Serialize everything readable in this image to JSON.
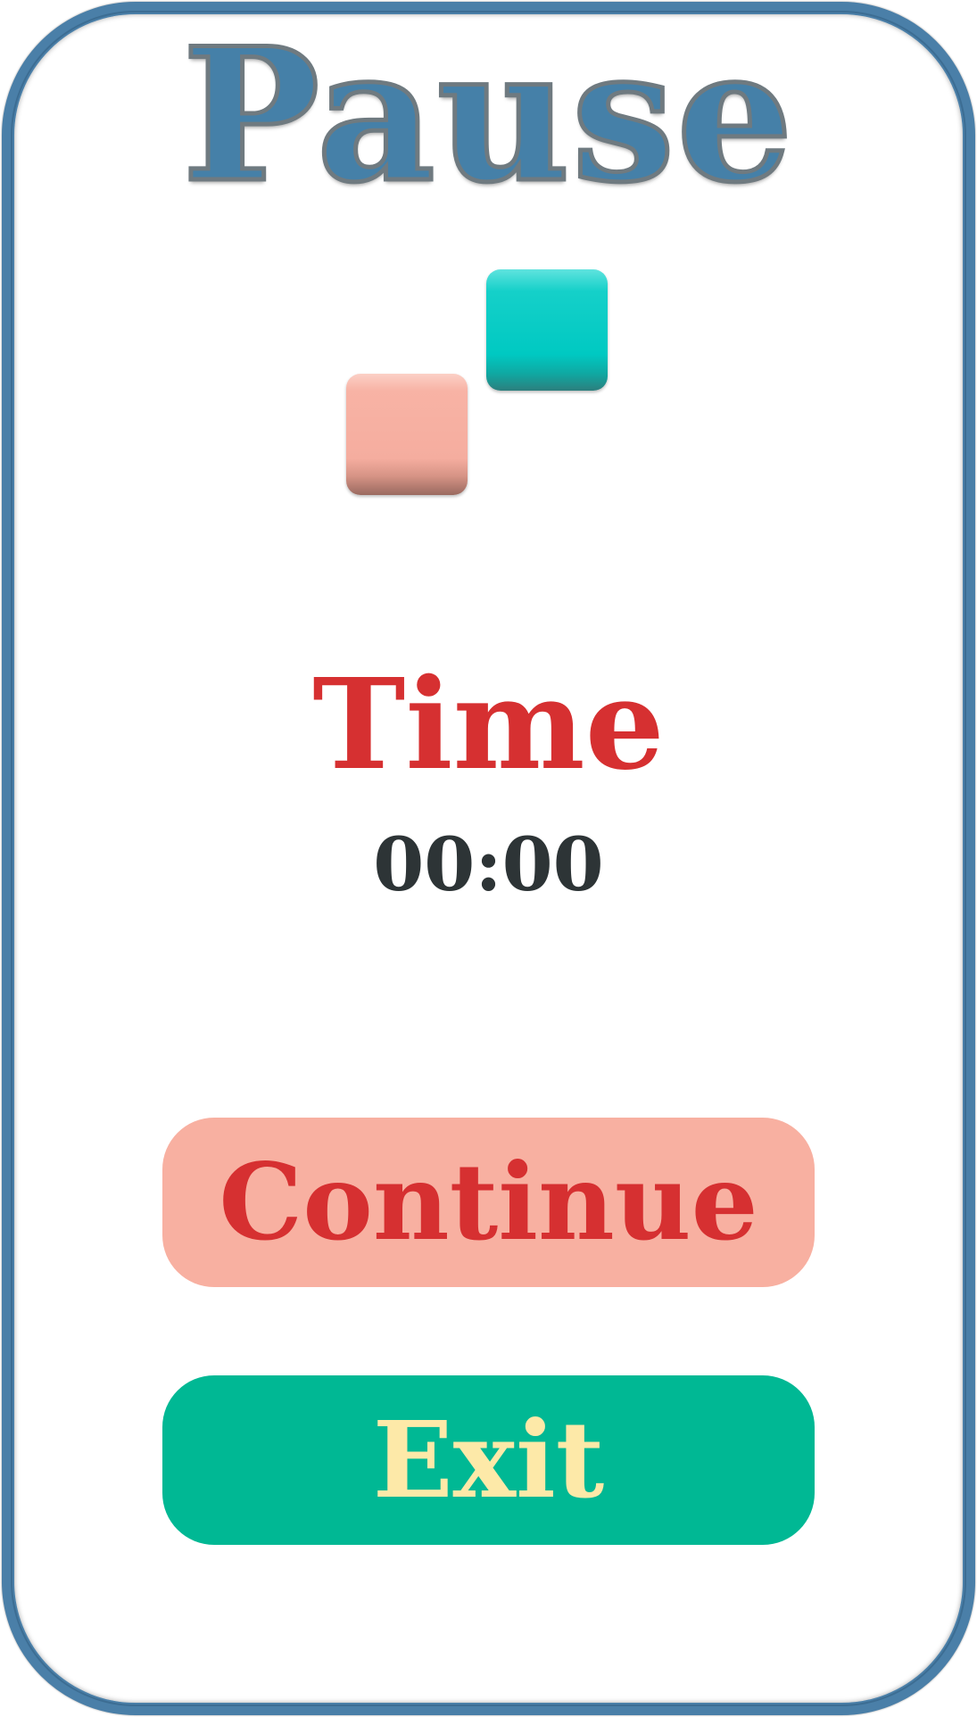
{
  "title": "Pause",
  "decor": {
    "block_colors": [
      "#00c9c2",
      "#f8b0a1"
    ]
  },
  "timer": {
    "label": "Time",
    "value": "00:00"
  },
  "buttons": {
    "continue_label": "Continue",
    "exit_label": "Exit"
  },
  "colors": {
    "frame": "#4a7fa8",
    "title": "#4580a8",
    "accent_red": "#d63031",
    "continue_bg": "#f8b0a1",
    "exit_bg": "#00b894",
    "exit_text": "#fde9a8",
    "timer_text": "#2d3436"
  }
}
